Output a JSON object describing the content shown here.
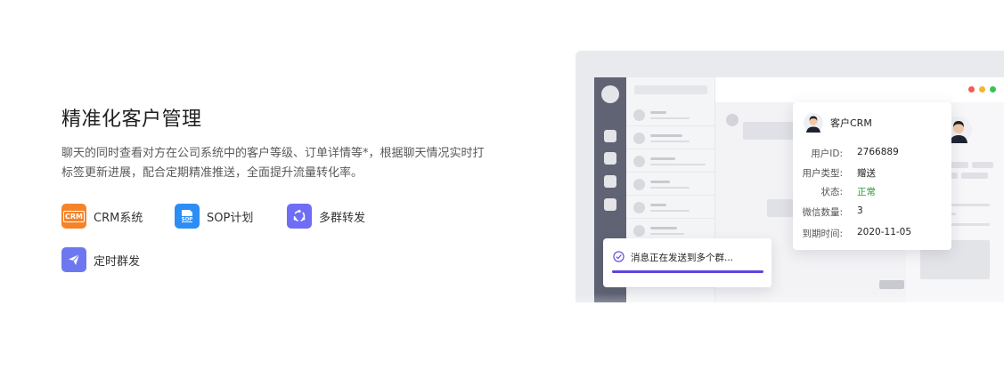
{
  "section": {
    "title": "精准化客户管理",
    "description": "聊天的同时查看对方在公司系统中的客户等级、订单详情等*，根据聊天情况实时打标签更新进展，配合定期精准推送，全面提升流量转化率。"
  },
  "features": [
    {
      "label": "CRM系统",
      "icon": "crm-icon",
      "icon_text": "CRM",
      "color": "#f5832a"
    },
    {
      "label": "SOP计划",
      "icon": "sop-icon",
      "icon_text": "SOP",
      "color": "#2c8ef5"
    },
    {
      "label": "多群转发",
      "icon": "forward-icon",
      "color": "#6f6cf5"
    },
    {
      "label": "定时群发",
      "icon": "send-icon",
      "color": "#6d78f0"
    }
  ],
  "crm_card": {
    "title": "客户CRM",
    "rows": [
      {
        "key": "用户ID:",
        "value": "2766889"
      },
      {
        "key": "用户类型:",
        "value": "赠送"
      },
      {
        "key": "状态:",
        "value": "正常",
        "status_color": "#2e9a3b"
      },
      {
        "key": "微信数量:",
        "value": "3"
      },
      {
        "key": "到期时间:",
        "value": "2020-11-05"
      }
    ]
  },
  "toast": {
    "text": "消息正在发送到多个群...",
    "progress": 1.0,
    "progress_color": "#5b45e0"
  },
  "window_dots": {
    "colors": [
      "#f25c54",
      "#f5b52e",
      "#39c25a"
    ]
  }
}
